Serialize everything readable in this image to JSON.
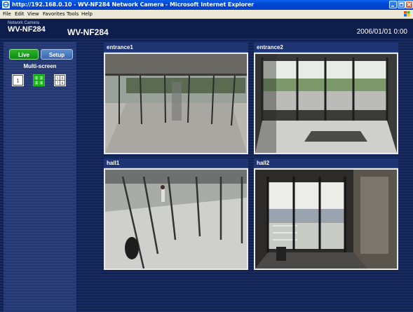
{
  "window": {
    "title": "http://192.168.0.10 - WV-NF284 Network Camera - Microsoft Internet Explorer"
  },
  "menu": {
    "items": [
      "File",
      "Edit",
      "View",
      "Favorites",
      "Tools",
      "Help"
    ]
  },
  "header": {
    "brand_small": "Network Camera",
    "brand_model": "WV-NF284",
    "model_title": "WV-NF284",
    "datetime": "2006/01/01  0:00"
  },
  "sidebar": {
    "tabs": {
      "live": "Live",
      "setup": "Setup"
    },
    "multiscreen_label": "Multi-screen",
    "multiscreen_buttons": {
      "single": "1",
      "quad_1_4": "1 2 3 4",
      "quad_5_8": "5 6 7 8"
    },
    "selected_layout": "quad_1_4"
  },
  "cameras": [
    {
      "name": "entrance1"
    },
    {
      "name": "entrance2"
    },
    {
      "name": "hall1"
    },
    {
      "name": "hall2"
    }
  ],
  "colors": {
    "header_bg": "#0d1e4d",
    "live_tab": "#15a018",
    "setup_tab": "#4a78bf"
  }
}
